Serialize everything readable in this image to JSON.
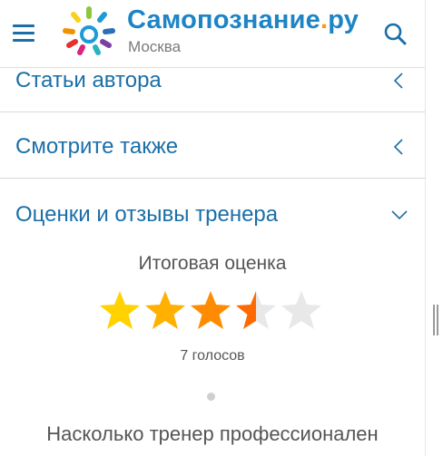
{
  "header": {
    "brand_name": "Самопознание",
    "brand_dot": ".",
    "brand_tld": "ру",
    "city": "Москва",
    "icons": {
      "menu": "hamburger-menu-icon",
      "search": "search-icon",
      "logo": "sun-logo-icon"
    },
    "colors": {
      "brand": "#1d84c6",
      "accent": "#ff9a00"
    }
  },
  "sections": [
    {
      "title": "Статьи автора",
      "state": "collapsed",
      "icon": "chevron-left-icon"
    },
    {
      "title": "Смотрите также",
      "state": "collapsed",
      "icon": "chevron-left-icon"
    },
    {
      "title": "Оценки и отзывы тренера",
      "state": "expanded",
      "icon": "chevron-down-icon"
    }
  ],
  "rating": {
    "title": "Итоговая оценка",
    "score": 3.5,
    "max": 5,
    "votes_label": "7 голосов",
    "star_colors": [
      "#ffd200",
      "#ffb000",
      "#ff8c00",
      "#ff6a00"
    ],
    "empty_star_color": "#e8e8e8"
  },
  "question": "Насколько тренер профессионален"
}
